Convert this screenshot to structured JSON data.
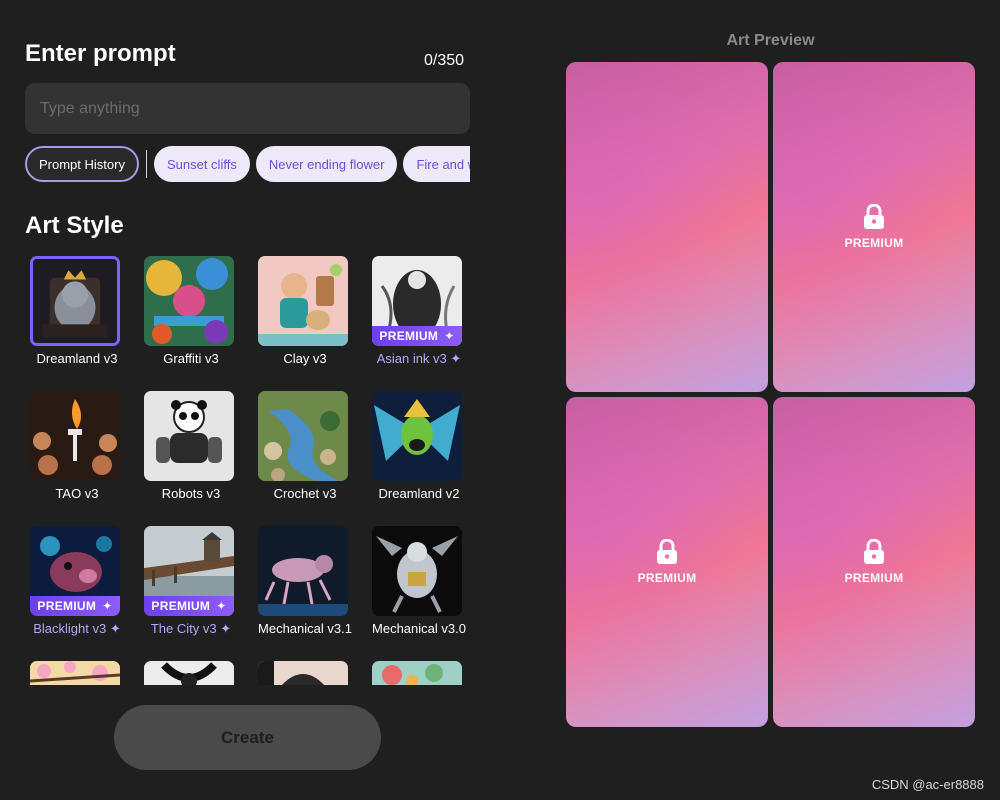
{
  "prompt": {
    "title": "Enter prompt",
    "counter": "0/350",
    "input_value": "",
    "placeholder": "Type anything"
  },
  "chips": {
    "history_label": "Prompt History",
    "suggestions": [
      "Sunset cliffs",
      "Never ending flower",
      "Fire and water"
    ]
  },
  "art_style": {
    "title": "Art Style",
    "premium_label": "PREMIUM",
    "styles": [
      {
        "label": "Dreamland v3",
        "premium": false,
        "selected": true
      },
      {
        "label": "Graffiti v3",
        "premium": false
      },
      {
        "label": "Clay v3",
        "premium": false
      },
      {
        "label": "Asian ink v3",
        "premium": true
      },
      {
        "label": "TAO v3",
        "premium": false
      },
      {
        "label": "Robots v3",
        "premium": false
      },
      {
        "label": "Crochet v3",
        "premium": false
      },
      {
        "label": "Dreamland v2",
        "premium": false
      },
      {
        "label": "Blacklight v3",
        "premium": true
      },
      {
        "label": "The City v3",
        "premium": true
      },
      {
        "label": "Mechanical v3.1",
        "premium": false
      },
      {
        "label": "Mechanical v3.0",
        "premium": false
      },
      {
        "label": "",
        "premium": false
      },
      {
        "label": "",
        "premium": false
      },
      {
        "label": "",
        "premium": false
      },
      {
        "label": "",
        "premium": false
      }
    ]
  },
  "create_button": "Create",
  "preview": {
    "title": "Art Preview",
    "cards": [
      {
        "locked": false,
        "label": ""
      },
      {
        "locked": true,
        "label": "PREMIUM"
      },
      {
        "locked": true,
        "label": "PREMIUM"
      },
      {
        "locked": true,
        "label": "PREMIUM"
      }
    ]
  },
  "watermark": "CSDN @ac-er8888",
  "colors": {
    "background": "#1f1f1f",
    "accent": "#7b63ff",
    "premium_text": "#b8a6ff"
  }
}
